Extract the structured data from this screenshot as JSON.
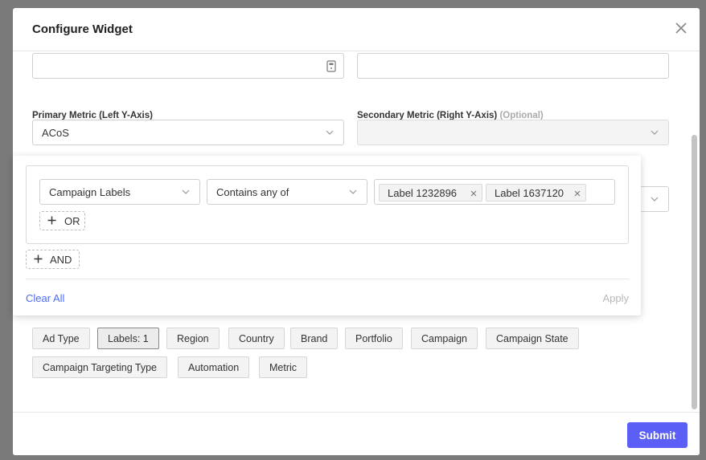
{
  "modal": {
    "title": "Configure Widget",
    "submit_label": "Submit"
  },
  "metrics": {
    "primary_label": "Primary Metric (Left Y-Axis)",
    "primary_value": "ACoS",
    "secondary_label": "Secondary Metric (Right Y-Axis)",
    "secondary_optional": "(Optional)",
    "secondary_value": ""
  },
  "top_fields": {
    "left_value": "",
    "right_value": ""
  },
  "filter_popover": {
    "field_select": "Campaign Labels",
    "operator_select": "Contains any of",
    "tags": [
      "Label 1232896",
      "Label 1637120"
    ],
    "or_label": "OR",
    "and_label": "AND",
    "clear_all_label": "Clear All",
    "apply_label": "Apply"
  },
  "chips": [
    "Ad Type",
    "Labels: 1",
    "Region",
    "Country",
    "Brand",
    "Portfolio",
    "Campaign",
    "Campaign State",
    "Campaign Targeting Type",
    "Automation",
    "Metric"
  ],
  "colors": {
    "primary_button": "#5b5ff5",
    "link": "#4a6cf7",
    "backdrop": "#7a7a7a"
  }
}
